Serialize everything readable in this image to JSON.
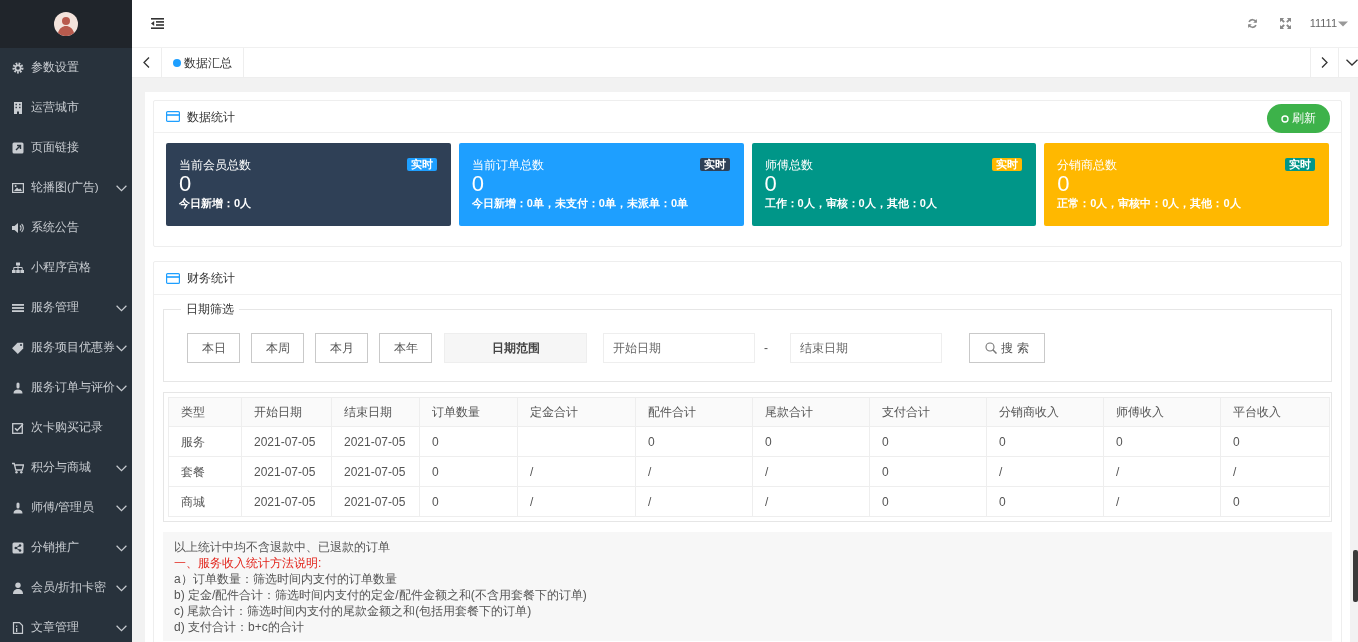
{
  "sidebar": {
    "items": [
      {
        "label": "参数设置",
        "has_submenu": false
      },
      {
        "label": "运营城市",
        "has_submenu": false
      },
      {
        "label": "页面链接",
        "has_submenu": false
      },
      {
        "label": "轮播图(广告)",
        "has_submenu": true
      },
      {
        "label": "系统公告",
        "has_submenu": false
      },
      {
        "label": "小程序宫格",
        "has_submenu": false
      },
      {
        "label": "服务管理",
        "has_submenu": true
      },
      {
        "label": "服务项目优惠券",
        "has_submenu": true
      },
      {
        "label": "服务订单与评价",
        "has_submenu": true
      },
      {
        "label": "次卡购买记录",
        "has_submenu": false
      },
      {
        "label": "积分与商城",
        "has_submenu": true
      },
      {
        "label": "师傅/管理员",
        "has_submenu": true
      },
      {
        "label": "分销推广",
        "has_submenu": true
      },
      {
        "label": "会员/折扣卡密",
        "has_submenu": true
      },
      {
        "label": "文章管理",
        "has_submenu": true
      }
    ]
  },
  "header": {
    "user": "11111"
  },
  "tabs": [
    {
      "label": "数据汇总",
      "selected": true
    }
  ],
  "stats_panel": {
    "title": "数据统计",
    "refresh_button": "刷新",
    "cards": [
      {
        "title": "当前会员总数",
        "badge": {
          "text": "实时",
          "color": "#1e9fff"
        },
        "value": "0",
        "detail": "今日新增：0人",
        "color": "#2f4056"
      },
      {
        "title": "当前订单总数",
        "badge": {
          "text": "实时",
          "color": "#2f4056"
        },
        "value": "0",
        "detail": "今日新增：0单，未支付：0单，未派单：0单",
        "color": "#1e9fff"
      },
      {
        "title": "师傅总数",
        "badge": {
          "text": "实时",
          "color": "#ffb800"
        },
        "value": "0",
        "detail": "工作：0人，审核：0人，其他：0人",
        "color": "#009688"
      },
      {
        "title": "分销商总数",
        "badge": {
          "text": "实时",
          "color": "#009688"
        },
        "value": "0",
        "detail": "正常：0人，审核中：0人，其他：0人",
        "color": "#ffb800"
      }
    ]
  },
  "finance_panel": {
    "title": "财务统计",
    "date_filter": {
      "legend": "日期筛选",
      "quick_buttons": [
        "本日",
        "本周",
        "本月",
        "本年"
      ],
      "range_label": "日期范围",
      "start_placeholder": "开始日期",
      "separator": "-",
      "end_placeholder": "结束日期",
      "search_button": "搜 索"
    },
    "table": {
      "columns": [
        "类型",
        "开始日期",
        "结束日期",
        "订单数量",
        "定金合计",
        "配件合计",
        "尾款合计",
        "支付合计",
        "分销商收入",
        "师傅收入",
        "平台收入"
      ],
      "rows": [
        [
          "服务",
          "2021-07-05",
          "2021-07-05",
          "0",
          null,
          "0",
          "0",
          "0",
          "0",
          "0",
          "0"
        ],
        [
          "套餐",
          "2021-07-05",
          "2021-07-05",
          "0",
          "/",
          "/",
          "/",
          "0",
          "/",
          "/",
          "/"
        ],
        [
          "商城",
          "2021-07-05",
          "2021-07-05",
          "0",
          "/",
          "/",
          "/",
          "0",
          "0",
          "/",
          "0"
        ]
      ]
    },
    "notes": [
      {
        "kind": "text",
        "text": "以上统计中均不含退款中、已退款的订单"
      },
      {
        "kind": "heading",
        "text": "一、服务收入统计方法说明:"
      },
      {
        "kind": "text",
        "text": "a）订单数量：筛选时间内支付的订单数量"
      },
      {
        "kind": "text",
        "text": "b) 定金/配件合计：筛选时间内支付的定金/配件金额之和(不含用套餐下的订单)"
      },
      {
        "kind": "text",
        "text": "c) 尾款合计：筛选时间内支付的尾款金额之和(包括用套餐下的订单)"
      },
      {
        "kind": "text",
        "text": "d) 支付合计：b+c的合计"
      }
    ]
  }
}
